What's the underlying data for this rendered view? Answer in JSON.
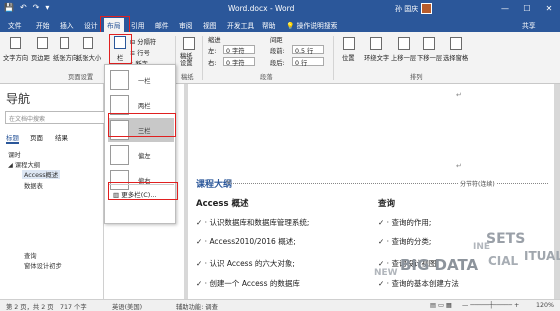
{
  "window": {
    "title": "Word.docx - Word",
    "user": "孙 国庆",
    "minimize": "—",
    "maximize": "☐",
    "close": "✕"
  },
  "qat": {
    "save": "💾",
    "undo": "↶",
    "redo": "↷",
    "more": "▾"
  },
  "tabs": [
    "文件",
    "开始",
    "插入",
    "设计",
    "布局",
    "引用",
    "邮件",
    "审阅",
    "视图",
    "开发工具",
    "帮助",
    "操作说明搜索",
    "共享"
  ],
  "active_tab": "布局",
  "ribbon": {
    "buttons": [
      "文字方向",
      "页边距",
      "纸张方向",
      "纸张大小",
      "栏"
    ],
    "breaks": "分隔符",
    "line_numbers": "行号",
    "hyphenation": "断字",
    "draft": "稿纸设置",
    "indent_label": "缩进",
    "spacing_label": "间距",
    "left_label": "左:",
    "right_label": "右:",
    "left_value": "0 字符",
    "right_value": "0 字符",
    "before_label": "段前:",
    "after_label": "段后:",
    "before_value": "0.5 行",
    "after_value": "0 行",
    "position": "位置",
    "wrap_text": "环绕文字",
    "bring_forward": "上移一层",
    "send_backward": "下移一层",
    "selection_pane": "选择窗格",
    "group_page_setup": "页面设置",
    "group_paragraph": "段落",
    "group_arrange": "排列",
    "group_draft": "稿纸"
  },
  "columns_menu": {
    "items": [
      "一栏",
      "两栏",
      "三栏",
      "偏左",
      "偏右"
    ],
    "selected": "三栏",
    "more": "更多栏(C)..."
  },
  "nav": {
    "title": "导航",
    "search_placeholder": "在文档中搜索",
    "tabs": [
      "标题",
      "页面",
      "结果"
    ],
    "items": [
      "课时",
      "课程大纲",
      "Access概述",
      "数据表",
      "查询",
      "窗体设计初步"
    ]
  },
  "document": {
    "marker": "↵",
    "heading": "课程大纲",
    "section_break": "分节符(连续)",
    "col1_title": "Access 概述",
    "col1": [
      "认识数据库和数据库管理系统;",
      "Access2010/2016 概述;",
      "认识 Access 的六大对象;",
      "创建一个 Access 的数据库"
    ],
    "col2_title": "查询",
    "col2": [
      "查询的作用;",
      "查询的分类;",
      "查询设计视图;",
      "查询的基本创建方法"
    ],
    "watermark": [
      "SETS",
      "BIG DATA",
      "CIAL",
      "ITUAL",
      "NEW",
      "INE"
    ]
  },
  "status": {
    "page": "第 2 页，共 2 页",
    "words": "717 个字",
    "lang": "英语(美国)",
    "assist": "辅助功能: 调查",
    "zoom": "120%"
  }
}
